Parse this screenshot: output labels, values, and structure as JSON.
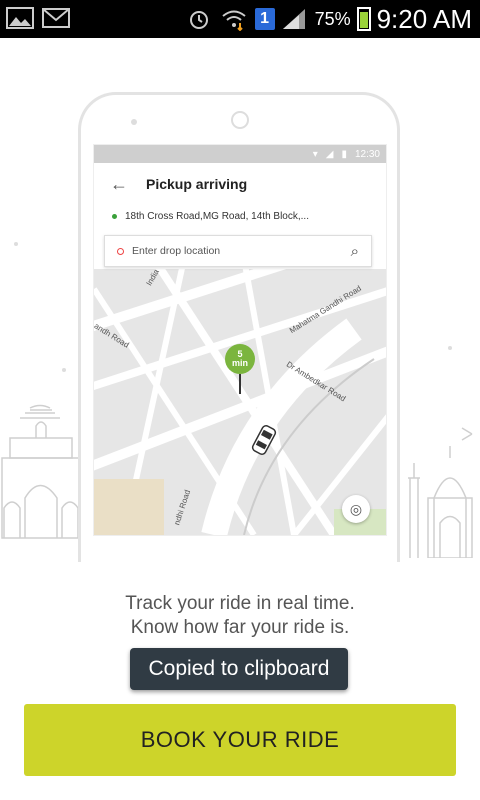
{
  "status_bar": {
    "battery_pct": "75%",
    "time": "9:20 AM",
    "badge": "1",
    "icons": [
      "gallery-icon",
      "gmail-icon",
      "alarm-icon",
      "wifi-icon",
      "signal-icon",
      "battery-icon"
    ]
  },
  "illustration": {
    "inner_status_time": "12:30",
    "header_title": "Pickup arriving",
    "pickup_address": "18th Cross Road,MG Road, 14th Block,...",
    "drop_placeholder": "Enter drop location",
    "pin_value": "5",
    "pin_unit": "min",
    "roads": [
      "Mahatma Gandhi Road",
      "Dr Ambedkar Road",
      "andh Road",
      "ndhi Road",
      "India"
    ]
  },
  "tagline": {
    "line1": "Track your ride in real time.",
    "line2": "Know how far your ride is."
  },
  "toast": "Copied to clipboard",
  "cta": "BOOK YOUR RIDE",
  "colors": {
    "accent": "#cdd42a",
    "toast_bg": "#303b44",
    "pin_green": "#7bb53e"
  }
}
